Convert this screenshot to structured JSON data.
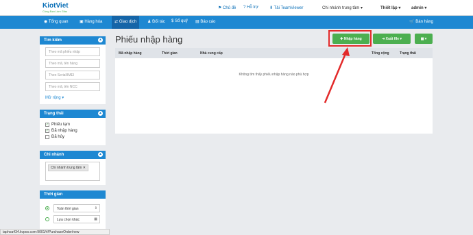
{
  "header": {
    "logo": "KiotViet",
    "logo_tagline": "Cùng Bạn Làm Giàu",
    "links": [
      "Chủ đề",
      "Hỗ trợ",
      "Tải TeamViewer"
    ],
    "branch": "Chi nhánh trung tâm",
    "settings": "Thiết lập",
    "user": "admin"
  },
  "nav": {
    "items": [
      "Tổng quan",
      "Hàng hóa",
      "Giao dịch",
      "Đối tác",
      "Sổ quỹ",
      "Báo cáo"
    ],
    "sell": "Bán hàng"
  },
  "sidebar": {
    "search_title": "Tìm kiếm",
    "inputs": [
      "Theo mã phiếu nhập",
      "Theo mã, tên hàng",
      "Theo Serial/IMEI",
      "Theo mã, tên NCC"
    ],
    "more": "Mở rộng",
    "status_title": "Trạng thái",
    "statuses": [
      "Phiếu tạm",
      "Đã nhập hàng",
      "Đã hủy"
    ],
    "branch_title": "Chi nhánh",
    "branch_tag": "Chi nhánh trung tâm",
    "time_title": "Thời gian",
    "time_all": "Toàn thời gian",
    "time_custom": "Lựa chọn khác"
  },
  "main": {
    "title": "Phiếu nhập hàng",
    "add_btn": "Nhập hàng",
    "export_btn": "Xuất file",
    "columns": [
      "Mã nhập hàng",
      "Thời gian",
      "Nhà cung cấp",
      "Tổng cộng",
      "Trạng thái"
    ],
    "empty_msg": "Không tìm thấy phiếu nhập hàng nào phù hợp"
  },
  "status_url": "taphoa434.kvpos.com:9001/#/PurchaseOrder/new",
  "colors": {
    "primary": "#1e88d2",
    "success": "#4caf50",
    "annotation": "#e32a2a"
  }
}
